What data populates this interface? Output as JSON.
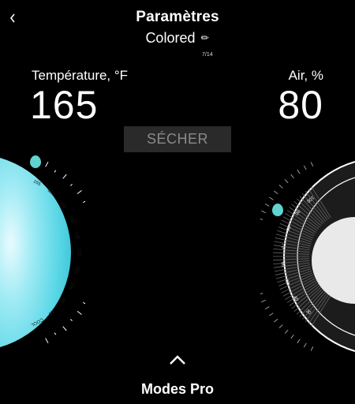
{
  "header": {
    "back_icon": "chevron-left-icon",
    "title": "Paramètres",
    "subtitle": "Colored",
    "edit_icon": "pencil-icon",
    "page_counter": "7/14"
  },
  "temperature": {
    "label": "Température, °F",
    "value": "165",
    "dial_ticks": [
      "165",
      "160",
      "150",
      "140",
      "130",
      "120",
      "115",
      "105",
      "95",
      "85",
      "COOL"
    ],
    "accent_color": "#5fd4d0"
  },
  "air": {
    "label": "Air, %",
    "value": "80",
    "dial_ticks": [
      "100",
      "90",
      "80",
      "70",
      "60",
      "50",
      "40",
      "30"
    ]
  },
  "action_button": {
    "label": "SÉCHER"
  },
  "footer": {
    "expand_icon": "chevron-up-icon",
    "label": "Modes Pro"
  }
}
